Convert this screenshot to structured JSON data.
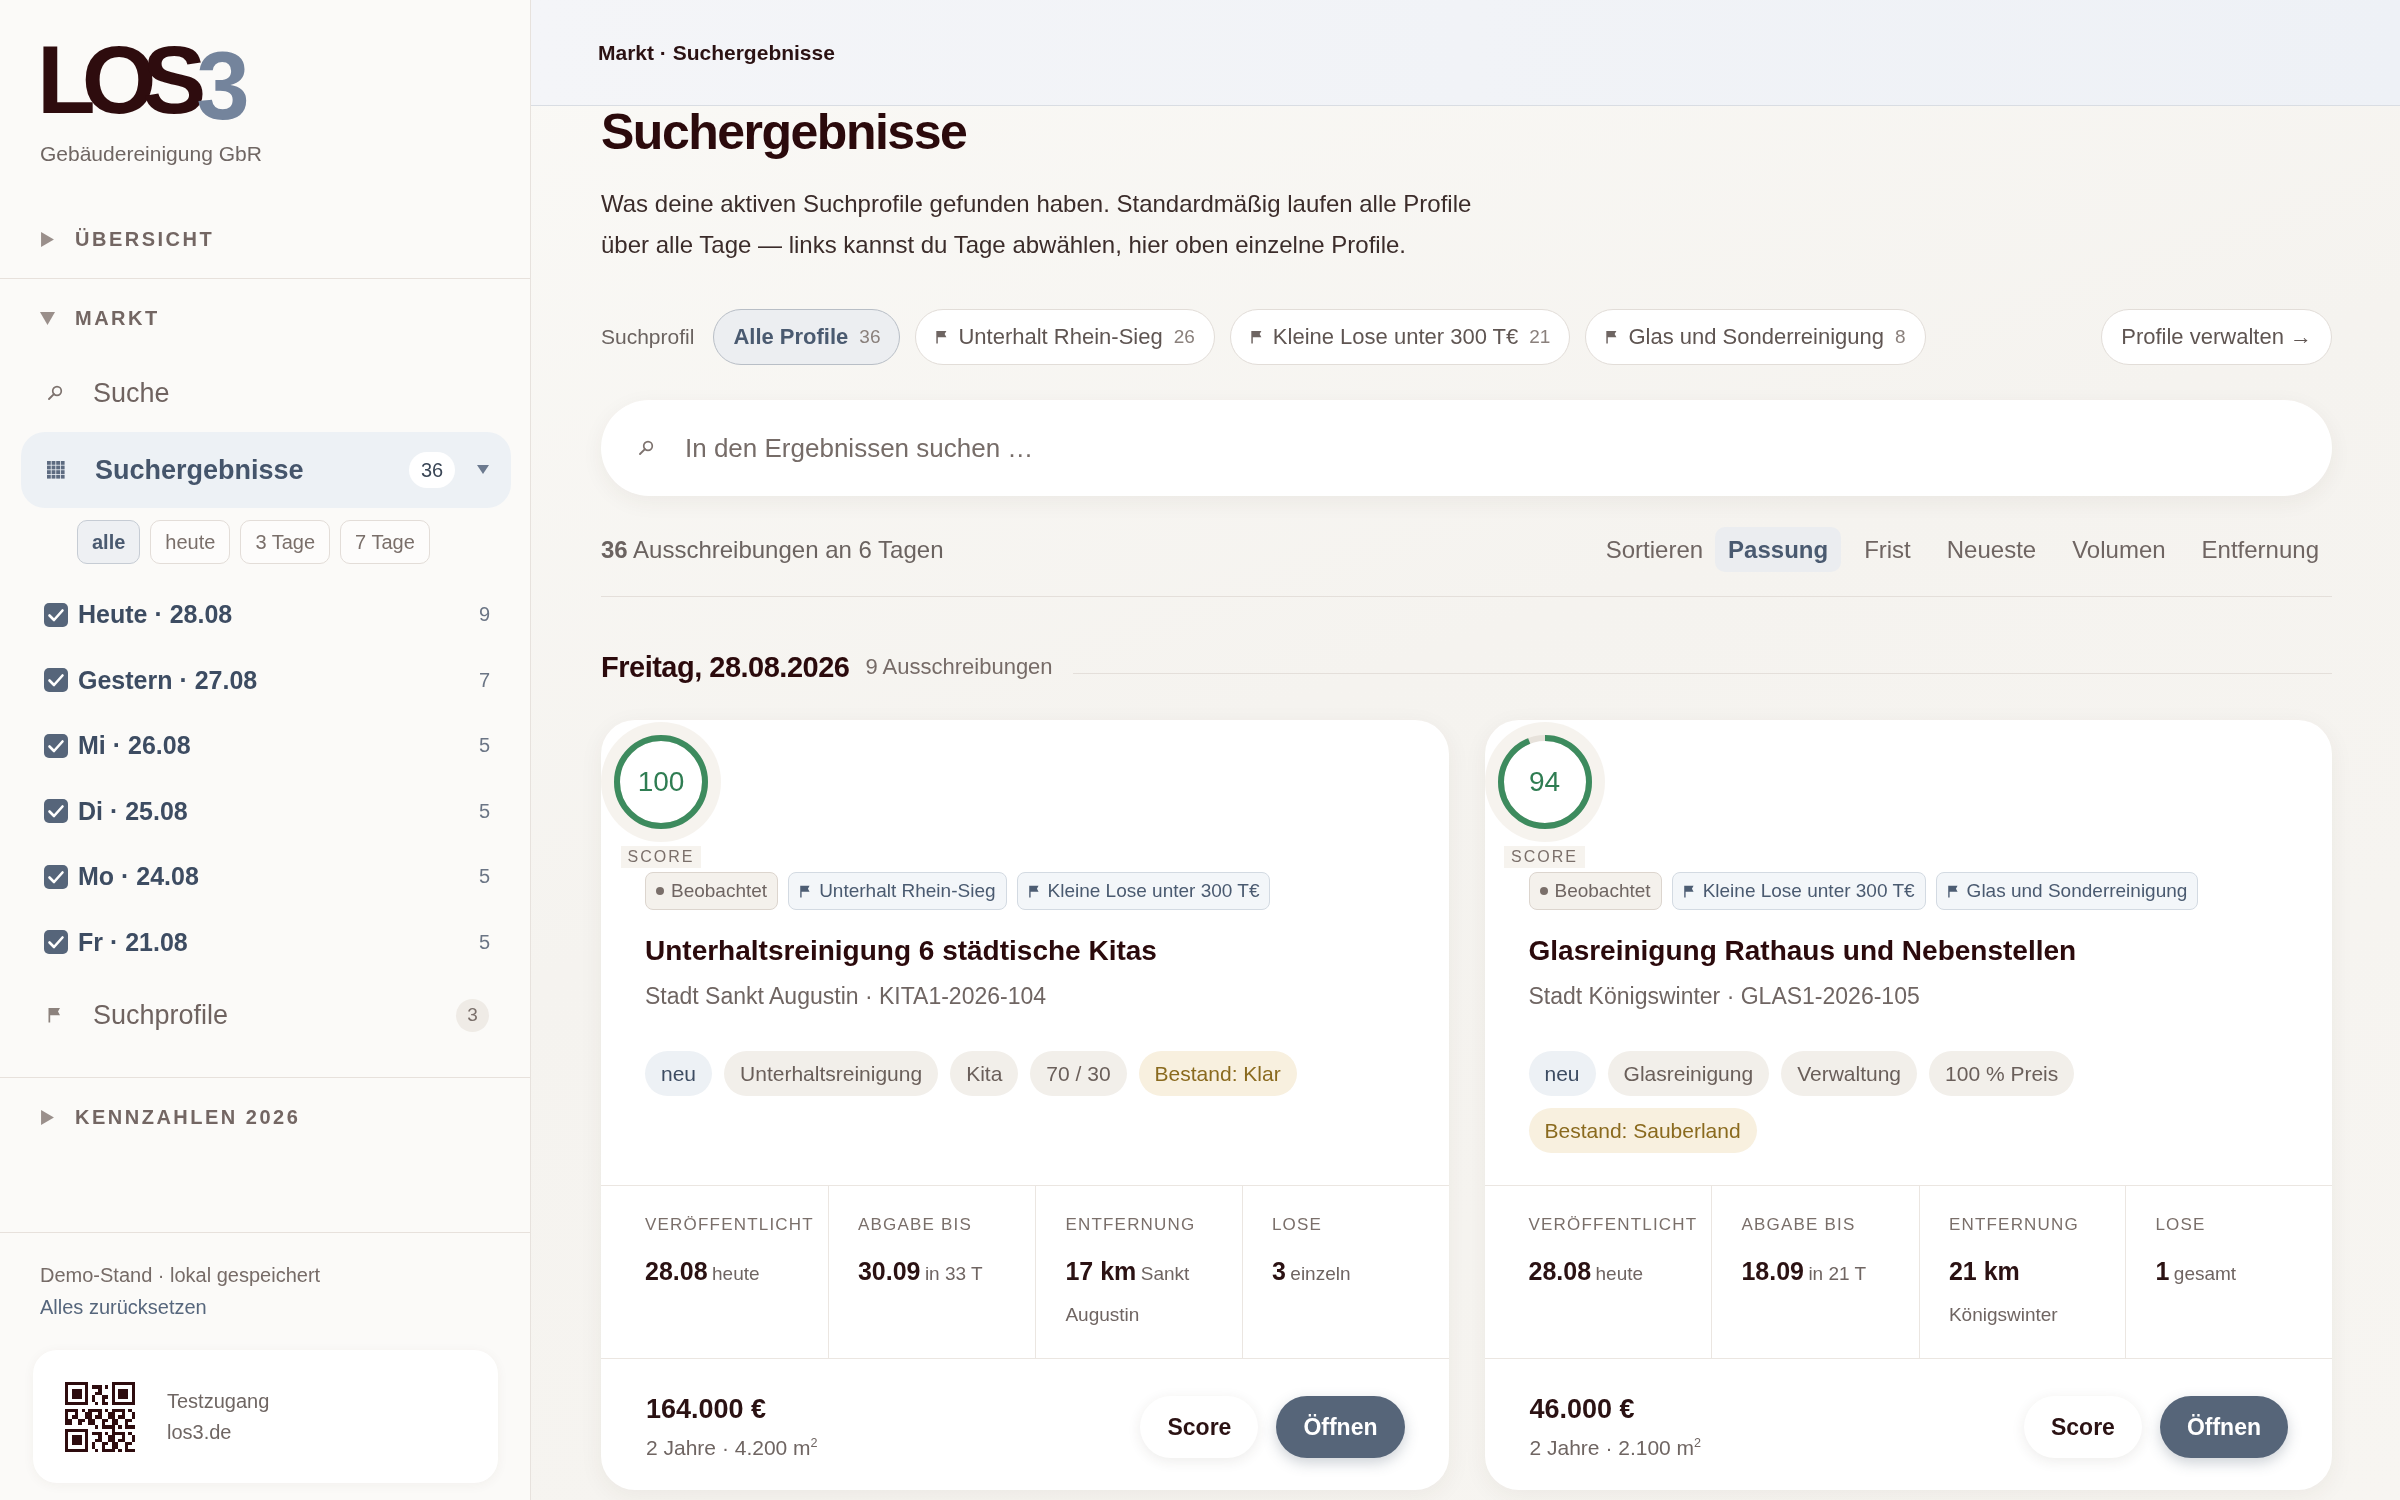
{
  "sidebar": {
    "logo": {
      "text": "LOS",
      "accent": "3"
    },
    "company": "Gebäudereinigung GbR",
    "sections": [
      {
        "title": "ÜBERSICHT",
        "expanded": false
      },
      {
        "title": "MARKT",
        "expanded": true,
        "items": [
          {
            "kind": "search",
            "label": "Suche",
            "selected": false
          },
          {
            "kind": "results",
            "label": "Suchergebnisse",
            "selected": true,
            "count": "36",
            "expanded": true,
            "ranges": [
              {
                "label": "alle",
                "selected": true
              },
              {
                "label": "heute",
                "selected": false
              },
              {
                "label": "3 Tage",
                "selected": false
              },
              {
                "label": "7 Tage",
                "selected": false
              }
            ],
            "days": [
              {
                "label": "Heute · 28.08",
                "count": "9",
                "checked": true
              },
              {
                "label": "Gestern · 27.08",
                "count": "7",
                "checked": true
              },
              {
                "label": "Mi · 26.08",
                "count": "5",
                "checked": true
              },
              {
                "label": "Di · 25.08",
                "count": "5",
                "checked": true
              },
              {
                "label": "Mo · 24.08",
                "count": "5",
                "checked": true
              },
              {
                "label": "Fr · 21.08",
                "count": "5",
                "checked": true
              }
            ]
          },
          {
            "kind": "profiles",
            "label": "Suchprofile",
            "selected": false,
            "count": "3"
          }
        ]
      },
      {
        "title": "KENNZAHLEN 2026",
        "expanded": false
      }
    ],
    "footer": {
      "status": "Demo-Stand · lokal gespeichert",
      "reset_link": "Alles zurücksetzen",
      "access_card": {
        "title": "Testzugang",
        "url": "los3.de"
      }
    }
  },
  "header": {
    "breadcrumb": "Markt · Suchergebnisse"
  },
  "page": {
    "title": "Suchergebnisse",
    "description": "Was deine aktiven Suchprofile gefunden haben. Standardmäßig laufen alle Profile über alle Tage — links kannst du Tage abwählen, hier oben einzelne Profile."
  },
  "profile_filter": {
    "label": "Suchprofil",
    "chips": [
      {
        "kind": "all",
        "label": "Alle Profile",
        "count": "36",
        "selected": true
      },
      {
        "kind": "profile",
        "label": "Unterhalt Rhein-Sieg",
        "count": "26",
        "selected": false
      },
      {
        "kind": "profile",
        "label": "Kleine Lose unter 300 T€",
        "count": "21",
        "selected": false
      },
      {
        "kind": "profile",
        "label": "Glas und Sonderreinigung",
        "count": "8",
        "selected": false
      }
    ],
    "manage_button": "Profile verwalten →"
  },
  "search": {
    "placeholder": "In den Ergebnissen suchen …"
  },
  "results_bar": {
    "summary": "**36** Ausschreibungen an 6 Tagen",
    "sort_label": "Sortieren",
    "sort_options": [
      {
        "label": "Passung",
        "selected": true
      },
      {
        "label": "Frist",
        "selected": false
      },
      {
        "label": "Neueste",
        "selected": false
      },
      {
        "label": "Volumen",
        "selected": false
      },
      {
        "label": "Entfernung",
        "selected": false
      }
    ]
  },
  "day_groups": [
    {
      "title": "Freitag, 28.08.2026",
      "count": "9 Ausschreibungen",
      "cards": [
        {
          "score": "100",
          "level": 1,
          "score_label": "SCORE",
          "badges": [
            {
              "kind": "watched",
              "label": "Beobachtet"
            },
            {
              "kind": "profile",
              "label": "Unterhalt Rhein-Sieg"
            },
            {
              "kind": "profile",
              "label": "Kleine Lose unter 300 T€"
            }
          ],
          "title": "Unterhaltsreinigung 6 städtische Kitas",
          "subtitle": "Stadt Sankt Augustin · KITA1-2026-104",
          "tags": [
            {
              "kind": "new",
              "label": "neu"
            },
            {
              "kind": "plain",
              "label": "Unterhaltsreinigung"
            },
            {
              "kind": "plain",
              "label": "Kita"
            },
            {
              "kind": "plain",
              "label": "70 / 30"
            },
            {
              "kind": "incumbent",
              "label": "Bestand: Klar"
            }
          ],
          "stats": [
            {
              "label": "VERÖFFENTLICHT",
              "value": "28.08",
              "note": "heute"
            },
            {
              "label": "ABGABE BIS",
              "value": "30.09",
              "note": "in 33 T"
            },
            {
              "label": "ENTFERNUNG",
              "value": "17 km",
              "note": "Sankt Augustin"
            },
            {
              "label": "LOSE",
              "value": "3",
              "note": "einzeln"
            }
          ],
          "price": "164.000 €",
          "details": "2 Jahre · 4.200 m$^{2}$",
          "secondary_button": "Score",
          "primary_button": "Öffnen"
        },
        {
          "score": "94",
          "level": 0.94,
          "score_label": "SCORE",
          "badges": [
            {
              "kind": "watched",
              "label": "Beobachtet"
            },
            {
              "kind": "profile",
              "label": "Kleine Lose unter 300 T€"
            },
            {
              "kind": "profile",
              "label": "Glas und Sonderreinigung"
            }
          ],
          "title": "Glasreinigung Rathaus und Nebenstellen",
          "subtitle": "Stadt Königswinter · GLAS1-2026-105",
          "tags": [
            {
              "kind": "new",
              "label": "neu"
            },
            {
              "kind": "plain",
              "label": "Glasreinigung"
            },
            {
              "kind": "plain",
              "label": "Verwaltung"
            },
            {
              "kind": "plain",
              "label": "100 % Preis"
            },
            {
              "kind": "incumbent",
              "label": "Bestand: Sauberland"
            }
          ],
          "stats": [
            {
              "label": "VERÖFFENTLICHT",
              "value": "28.08",
              "note": "heute"
            },
            {
              "label": "ABGABE BIS",
              "value": "18.09",
              "note": "in 21 T"
            },
            {
              "label": "ENTFERNUNG",
              "value": "21 km",
              "note": "Königswinter"
            },
            {
              "label": "LOSE",
              "value": "1",
              "note": "gesamt"
            }
          ],
          "price": "46.000 €",
          "details": "2 Jahre · 2.100 m$^{2}$",
          "secondary_button": "Score",
          "primary_button": "Öffnen"
        }
      ]
    }
  ]
}
